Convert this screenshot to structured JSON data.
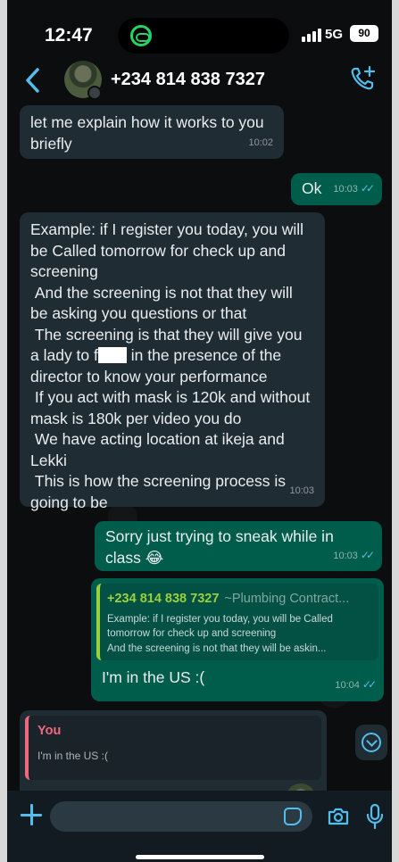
{
  "status_bar": {
    "time": "12:47",
    "network": "5G",
    "battery": "90"
  },
  "header": {
    "contact_name": "+234 814 838 7327",
    "back_icon": "chevron-left-icon",
    "call_icon": "add-call-icon"
  },
  "messages": [
    {
      "direction": "in",
      "text": "let me explain how it works to you briefly",
      "time": "10:02"
    },
    {
      "direction": "out",
      "text": "Ok",
      "time": "10:03",
      "read": true
    },
    {
      "direction": "in",
      "text_before_censor": "Example: if I register you today, you will be Called tomorrow for check up and screening\n And the screening is not that they will be asking you questions or that\n The screening is that they will give you a lady to f",
      "text_after_censor": " in the presence of the director to know your performance\n If you act with mask is 120k and without mask is 180k per video you do\n We have acting location at ikeja and Lekki\n This is how the screening process is going to be",
      "time": "10:03"
    },
    {
      "direction": "out",
      "text": "Sorry just trying to sneak while in class 😂",
      "time": "10:03",
      "read": true
    },
    {
      "direction": "out",
      "quote_author": "+234 814 838 7327",
      "quote_subtitle": "~Plumbing Contract...",
      "quote_lines": [
        "Example: if I register you today, you will be Called",
        "tomorrow for check up and screening",
        " And the screening is not that they will be askin..."
      ],
      "text": "I'm in the US :(",
      "time": "10:04",
      "read": true
    },
    {
      "direction": "in",
      "quote_author": "You",
      "quote_text": "I'm in the US :("
    }
  ],
  "composer": {
    "value": "",
    "placeholder": ""
  },
  "colors": {
    "background": "#0b0d0e",
    "incoming_bubble": "#202c33",
    "outgoing_bubble": "#005c4b",
    "accent": "#53bdeb",
    "quote_green": "#9bd13d",
    "quote_red": "#f0697f"
  }
}
